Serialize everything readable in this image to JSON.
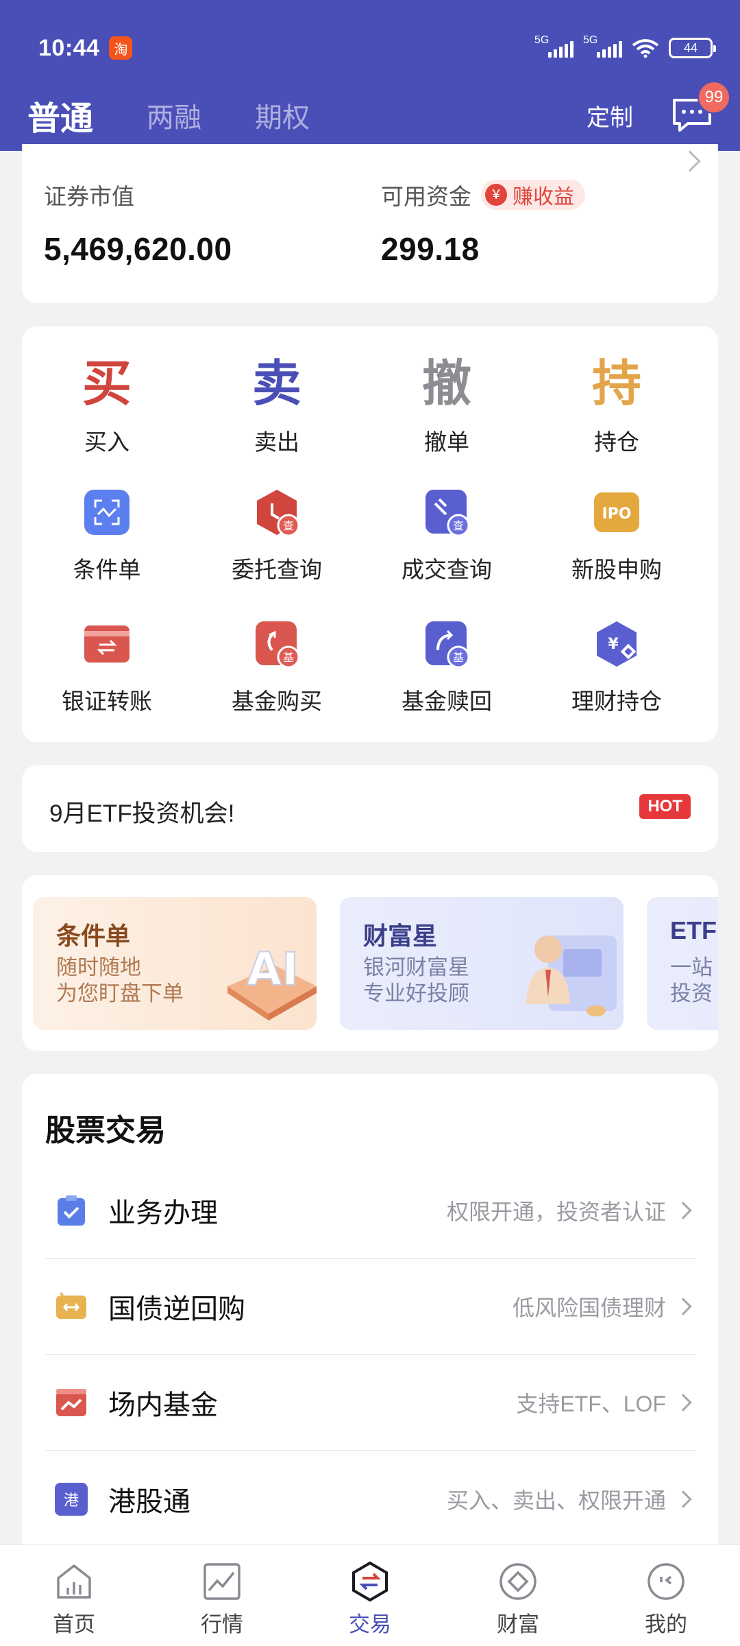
{
  "status_bar": {
    "time": "10:44",
    "network1": "5G",
    "network2": "5G",
    "battery": "44"
  },
  "header": {
    "tabs": [
      {
        "label": "普通",
        "active": true
      },
      {
        "label": "两融",
        "active": false
      },
      {
        "label": "期权",
        "active": false
      }
    ],
    "customize_label": "定制",
    "message_badge": "99"
  },
  "assets": {
    "market_value_label": "证券市值",
    "market_value": "5,469,620.00",
    "available_label": "可用资金",
    "available_value": "299.18",
    "earn_label": "赚收益",
    "earn_icon": "¥"
  },
  "functions": {
    "row1": [
      {
        "char": "买",
        "label": "买入",
        "color": "#d0453e"
      },
      {
        "char": "卖",
        "label": "卖出",
        "color": "#4a4fb8"
      },
      {
        "char": "撤",
        "label": "撤单",
        "color": "#8c8c92"
      },
      {
        "char": "持",
        "label": "持仓",
        "color": "#e3a44a"
      }
    ],
    "row2": [
      {
        "label": "条件单",
        "icon": "condition-order-icon"
      },
      {
        "label": "委托查询",
        "icon": "order-query-icon",
        "badge": "查"
      },
      {
        "label": "成交查询",
        "icon": "deal-query-icon",
        "badge": "查"
      },
      {
        "label": "新股申购",
        "icon": "ipo-icon",
        "badge": "IPO"
      }
    ],
    "row3": [
      {
        "label": "银证转账",
        "icon": "bank-transfer-icon"
      },
      {
        "label": "基金购买",
        "icon": "fund-buy-icon",
        "badge": "基"
      },
      {
        "label": "基金赎回",
        "icon": "fund-redeem-icon",
        "badge": "基"
      },
      {
        "label": "理财持仓",
        "icon": "wealth-holding-icon",
        "badge": "¥"
      }
    ]
  },
  "etf_notice": {
    "text": "9月ETF投资机会!",
    "badge": "HOT"
  },
  "banners": [
    {
      "title": "条件单",
      "line1": "随时随地",
      "line2": "为您盯盘下单",
      "art": "AI"
    },
    {
      "title": "财富星",
      "line1": "银河财富星",
      "line2": "专业好投顾"
    },
    {
      "title": "ETF",
      "line1": "一站",
      "line2": "投资"
    }
  ],
  "stock_trading": {
    "title": "股票交易",
    "rows": [
      {
        "label": "业务办理",
        "hint": "权限开通，投资者认证",
        "icon": "business-check-icon",
        "color": "#5a7ee8"
      },
      {
        "label": "国债逆回购",
        "hint": "低风险国债理财",
        "icon": "bond-repo-icon",
        "color": "#e7b24f"
      },
      {
        "label": "场内基金",
        "hint": "支持ETF、LOF",
        "icon": "exchange-fund-icon",
        "color": "#d9574f"
      },
      {
        "label": "港股通",
        "hint": "买入、卖出、权限开通",
        "icon": "hk-connect-icon",
        "color": "#5a5fd0",
        "icon_text": "港"
      }
    ]
  },
  "bottom_nav": [
    {
      "label": "首页",
      "icon": "home-icon",
      "active": false
    },
    {
      "label": "行情",
      "icon": "market-icon",
      "active": false
    },
    {
      "label": "交易",
      "icon": "trade-icon",
      "active": true
    },
    {
      "label": "财富",
      "icon": "wealth-icon",
      "active": false
    },
    {
      "label": "我的",
      "icon": "profile-icon",
      "active": false
    }
  ]
}
